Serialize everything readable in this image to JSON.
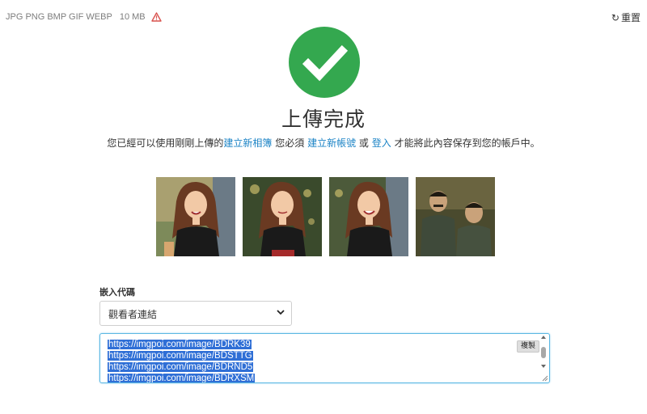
{
  "topbar": {
    "formats": "JPG PNG BMP GIF WEBP",
    "size_limit": "10 MB",
    "warning_icon": "warning-triangle-icon",
    "reset_label": "重置",
    "reset_icon": "refresh-icon"
  },
  "status": {
    "icon": "checkmark-circle-icon",
    "icon_color": "#34a84f",
    "title": "上傳完成"
  },
  "message": {
    "part1": "您已經可以使用剛剛上傳的",
    "link_album": "建立新相簿",
    "part2": " 您必須 ",
    "link_signup": "建立新帳號",
    "part3": " 或 ",
    "link_login": "登入",
    "part4": " 才能將此內容保存到您的帳戶中。",
    "link_color": "#1d84c6"
  },
  "thumbnails": [
    {
      "alt": "girl-portrait-1"
    },
    {
      "alt": "girl-portrait-2"
    },
    {
      "alt": "girl-portrait-3"
    },
    {
      "alt": "two-men-portrait"
    }
  ],
  "embed": {
    "label": "嵌入代碼",
    "selected_option": "觀看者連結",
    "links": [
      "https://imgpoi.com/image/BDRK39",
      "https://imgpoi.com/image/BDSTTG",
      "https://imgpoi.com/image/BDRND5",
      "https://imgpoi.com/image/BDRXSM"
    ],
    "copy_label": "複製"
  }
}
